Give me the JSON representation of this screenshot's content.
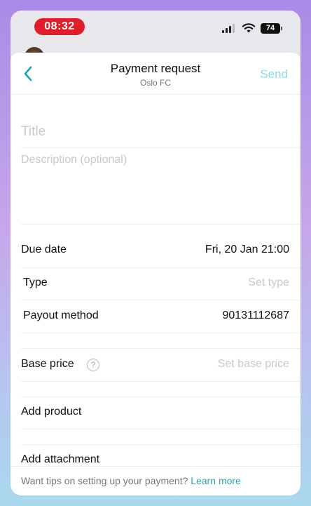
{
  "status_bar": {
    "time": "08:32",
    "battery": "74",
    "signal_bars": 3
  },
  "nav": {
    "title": "Payment request",
    "subtitle": "Oslo FC",
    "send_label": "Send"
  },
  "form": {
    "title_placeholder": "Title",
    "description_placeholder": "Description (optional)"
  },
  "rows": {
    "due_date": {
      "label": "Due date",
      "value": "Fri, 20 Jan  21:00"
    },
    "type": {
      "label": "Type",
      "value": "Set type"
    },
    "payout": {
      "label": "Payout method",
      "value": "90131112687"
    },
    "base_price": {
      "label": "Base price",
      "value": "Set base price",
      "help": "?"
    },
    "add_product": {
      "label": "Add product"
    },
    "add_attachment": {
      "label": "Add attachment"
    }
  },
  "footer": {
    "text": "Want tips on setting up your payment?",
    "link": "Learn more"
  },
  "colors": {
    "accent": "#18aabc",
    "send_disabled": "#8fd9e6",
    "time_pill": "#e11d2a"
  }
}
